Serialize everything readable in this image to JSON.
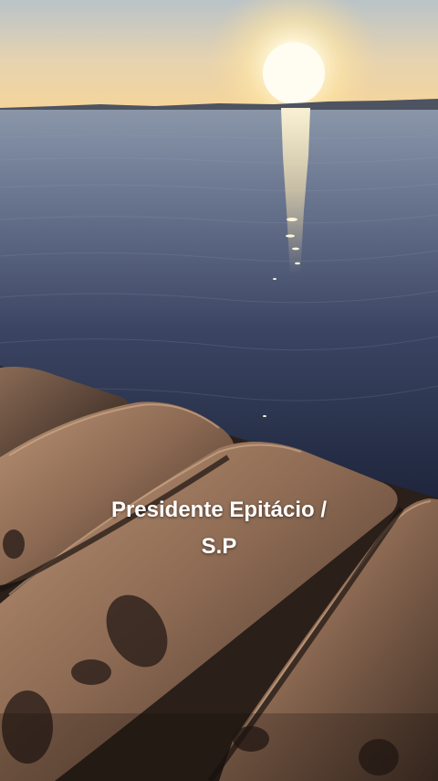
{
  "caption": {
    "line1": "Presidente Epitácio /",
    "line2": "S.P"
  },
  "scene": {
    "subject": "sunset-over-water-with-concrete-breakwater",
    "colors": {
      "sky_top": "#b9c2c6",
      "sky_horizon": "#f3d6a0",
      "sun": "#fffbe6",
      "water_far": "#6f7d94",
      "water_near": "#1f2740",
      "concrete_light": "#a8866a",
      "concrete_dark": "#3a2b22"
    }
  }
}
